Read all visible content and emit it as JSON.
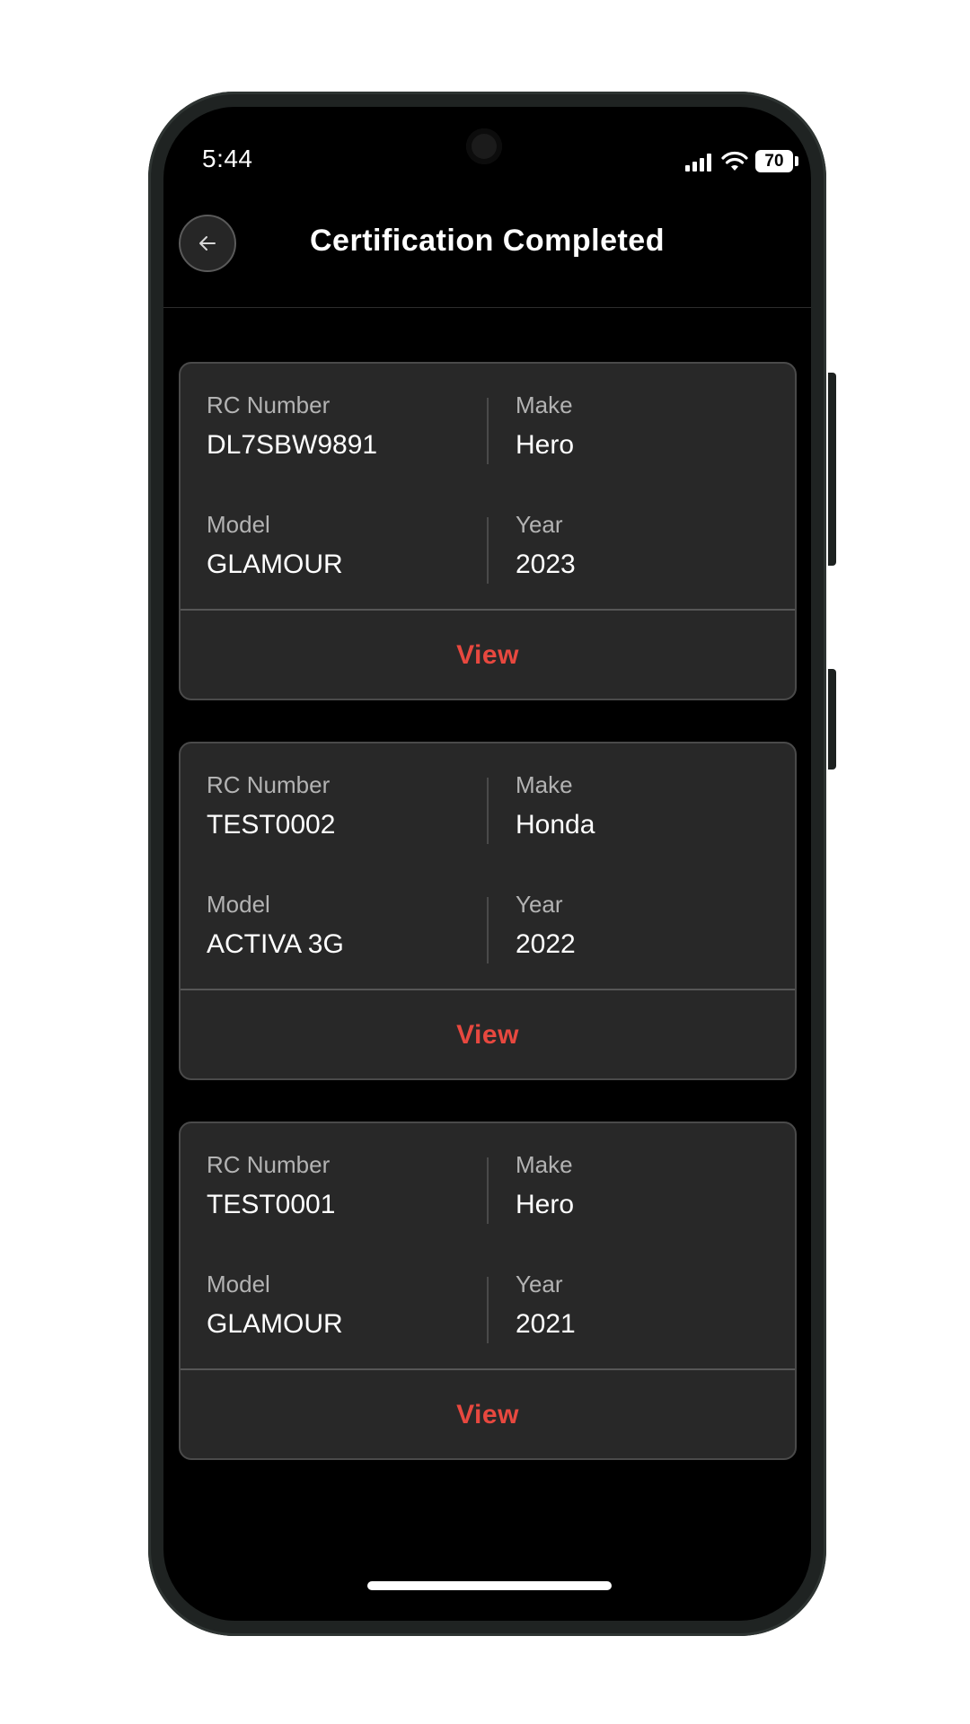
{
  "status_bar": {
    "time": "5:44",
    "battery": "70",
    "icons": [
      "signal-icon",
      "wifi-icon",
      "battery-icon"
    ]
  },
  "header": {
    "title": "Certification Completed",
    "back_icon": "arrow-left-icon"
  },
  "labels": {
    "rc_number": "RC Number",
    "make": "Make",
    "model": "Model",
    "year": "Year",
    "view": "View"
  },
  "certifications": [
    {
      "rc_number": "DL7SBW9891",
      "make": "Hero",
      "model": "GLAMOUR",
      "year": "2023"
    },
    {
      "rc_number": "TEST0002",
      "make": "Honda",
      "model": "ACTIVA 3G",
      "year": "2022"
    },
    {
      "rc_number": "TEST0001",
      "make": "Hero",
      "model": "GLAMOUR",
      "year": "2021"
    }
  ],
  "colors": {
    "background": "#000000",
    "card": "#282828",
    "card_border": "#4a4a4a",
    "accent": "#e8483f",
    "label": "#b3b3b3",
    "value": "#ffffff"
  }
}
